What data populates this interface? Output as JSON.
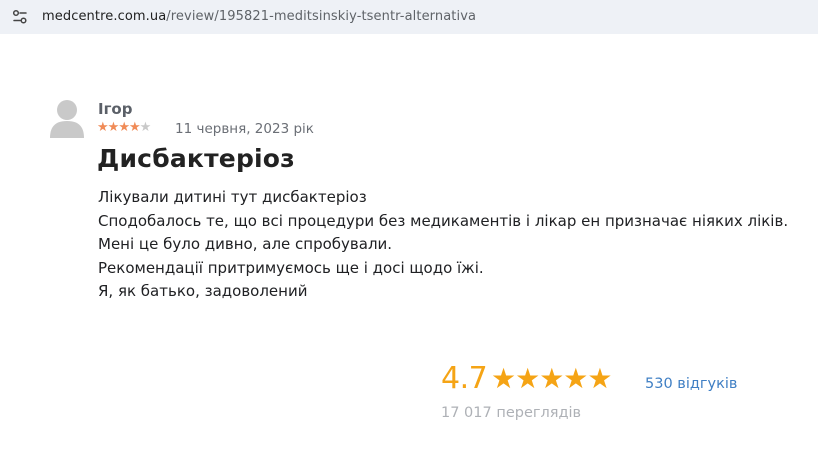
{
  "browser": {
    "url_host": "medcentre.com.ua",
    "url_path": "/review/195821-meditsinskiy-tsentr-alternativa",
    "site_info_icon": "tune-icon"
  },
  "review": {
    "author": "Ігор",
    "rating": 4,
    "rating_max": 5,
    "date": "11 червня, 2023 рік",
    "title": "Дисбактеріоз",
    "body": [
      "Лікували дитині тут дисбактеріоз",
      "Сподобалось те, що всі процедури без медикаментів і лікар ен призначає ніяких ліків.",
      "Мені це було дивно, але спробували.",
      "Рекомендації притримуємось ще і досі щодо їжі.",
      "Я, як батько, задоволений"
    ],
    "star_color": "#f08b57"
  },
  "summary": {
    "rating": "4.7",
    "stars": "★★★★★",
    "reviews_link": "530 відгуків",
    "views": "17 017 переглядів",
    "accent_color": "#f5a415"
  }
}
